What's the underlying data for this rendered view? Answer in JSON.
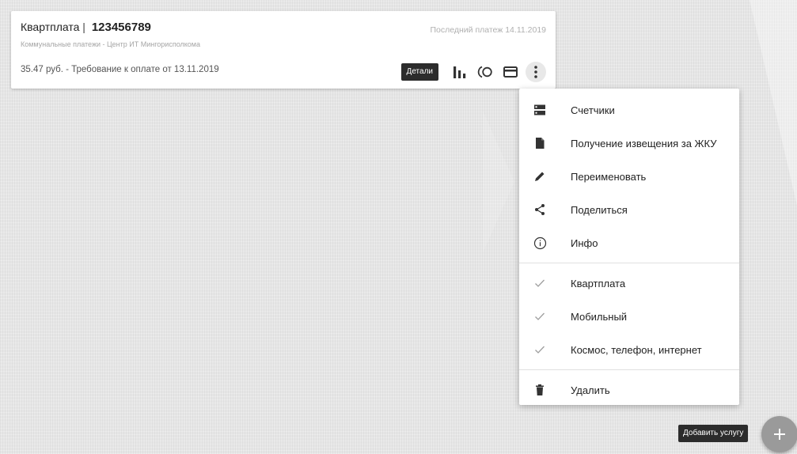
{
  "card": {
    "service_name": "Квартплата",
    "separator": "|",
    "account_number": "123456789",
    "provider": "Коммунальные платежи - Центр ИТ Мингорисполкома",
    "last_payment": "Последний платеж 14.11.2019",
    "amount": "35.47 руб.",
    "requirement": " - Требование к оплате от 13.11.2019",
    "details_label": "Детали",
    "icons": [
      "bar-chart-icon",
      "autopay-icon",
      "card-icon",
      "more-vert-icon"
    ]
  },
  "menu": {
    "items": [
      {
        "label": "Счетчики",
        "icon": "meters-icon"
      },
      {
        "label": "Получение извещения за ЖКУ",
        "icon": "document-icon"
      },
      {
        "label": "Переименовать",
        "icon": "pencil-icon"
      },
      {
        "label": "Поделиться",
        "icon": "share-icon"
      },
      {
        "label": "Инфо",
        "icon": "info-icon"
      }
    ],
    "groups": [
      {
        "label": "Квартплата",
        "checked": true
      },
      {
        "label": "Мобильный",
        "checked": true
      },
      {
        "label": "Космос, телефон, интернет",
        "checked": true
      }
    ],
    "delete_label": "Удалить"
  },
  "add_service_label": "Добавить услугу",
  "colors": {
    "background": "#e6e6e6",
    "card": "#ffffff",
    "dark_button": "#2c2c2c",
    "icon": "#333333",
    "check": "#9e9e9e",
    "fab": "#9a9a9a"
  }
}
